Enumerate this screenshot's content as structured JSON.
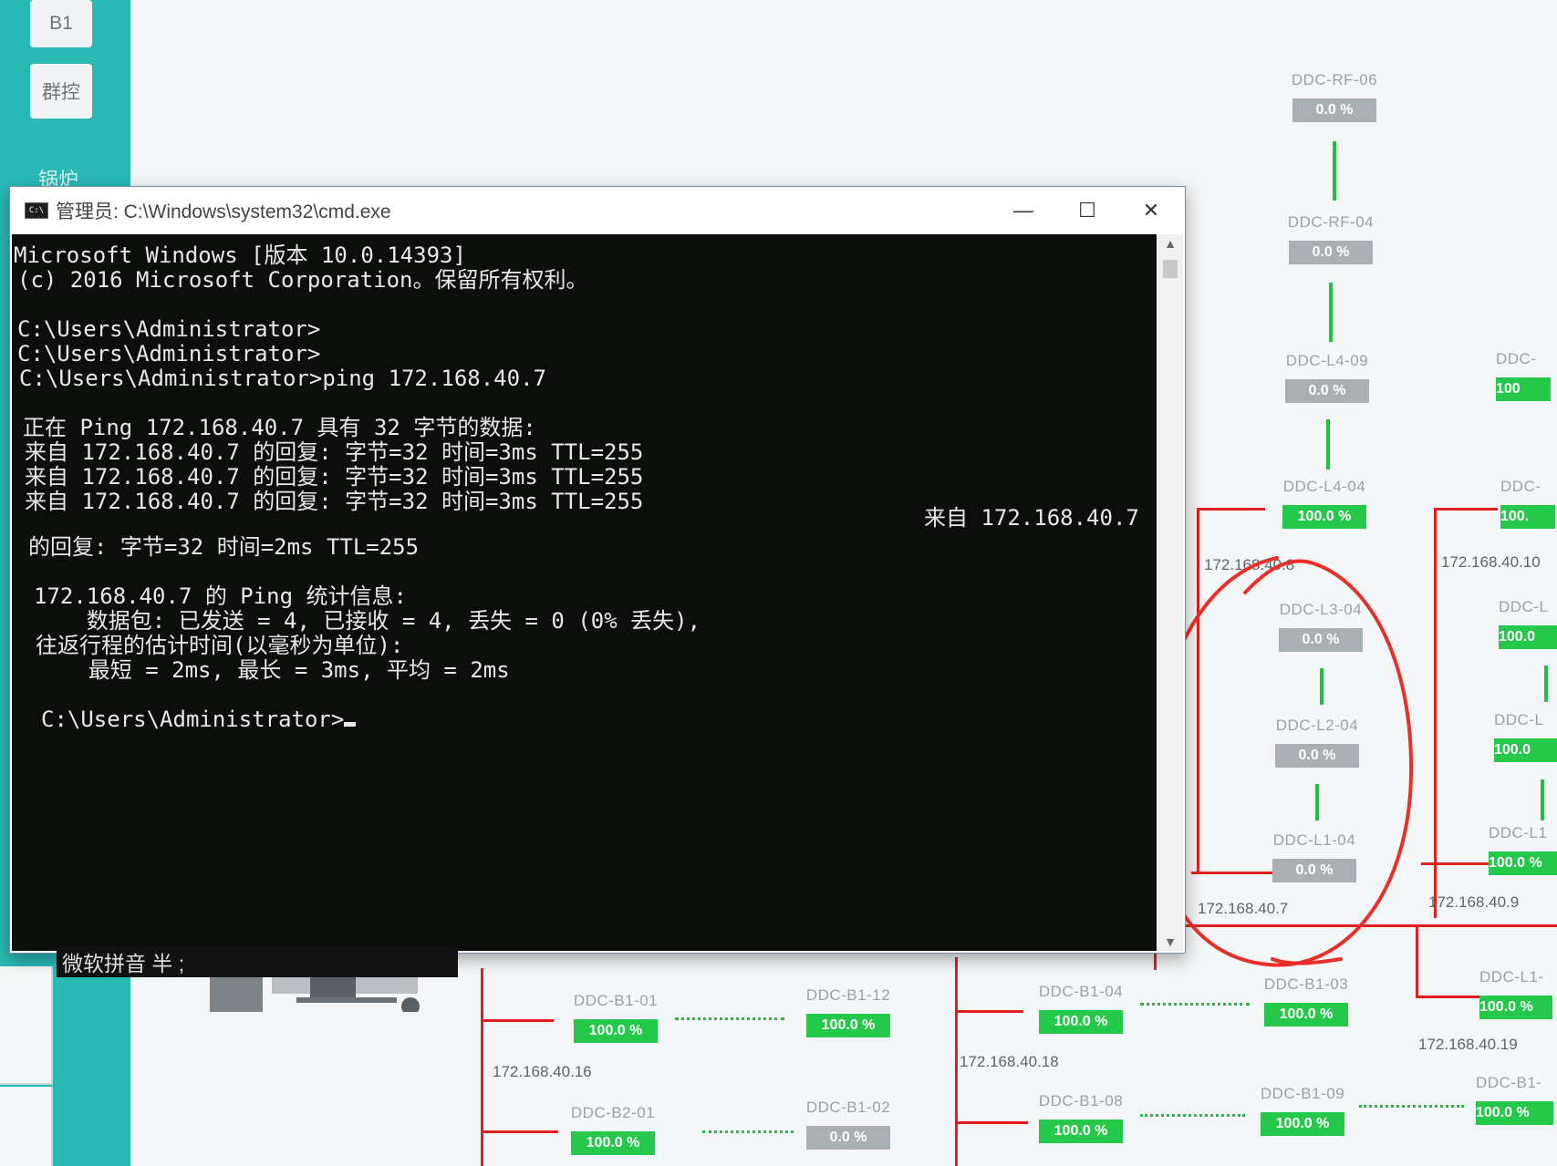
{
  "sidebar": {
    "buttons": [
      "B1",
      "群控"
    ],
    "label": "锅炉"
  },
  "topology": {
    "nodes": [
      {
        "label": "DDC-RF-06",
        "badge": "0.0 %",
        "ok": false
      },
      {
        "label": "DDC-RF-04",
        "badge": "0.0 %",
        "ok": false
      },
      {
        "label": "DDC-L4-09",
        "badge": "0.0 %",
        "ok": false
      },
      {
        "label": "DDC-L4-04",
        "badge": "100.0 %",
        "ok": true
      },
      {
        "label": "DDC-L3-04",
        "badge": "0.0 %",
        "ok": false
      },
      {
        "label": "DDC-L2-04",
        "badge": "0.0 %",
        "ok": false
      },
      {
        "label": "DDC-L1-04",
        "badge": "0.0 %",
        "ok": false
      },
      {
        "label": "DDC-",
        "badge": "100",
        "ok": true
      },
      {
        "label": "DDC-",
        "badge": "100.",
        "ok": true
      },
      {
        "label": "DDC-L",
        "badge": "100.0",
        "ok": true
      },
      {
        "label": "DDC-L",
        "badge": "100.0",
        "ok": true
      },
      {
        "label": "DDC-L1",
        "badge": "100.0 %",
        "ok": true
      },
      {
        "label": "DDC-B1-01",
        "badge": "100.0 %",
        "ok": true
      },
      {
        "label": "DDC-B1-12",
        "badge": "100.0 %",
        "ok": true
      },
      {
        "label": "DDC-B1-04",
        "badge": "100.0 %",
        "ok": true
      },
      {
        "label": "DDC-B1-03",
        "badge": "100.0 %",
        "ok": true
      },
      {
        "label": "DDC-L1-",
        "badge": "100.0 %",
        "ok": true
      },
      {
        "label": "DDC-B2-01",
        "badge": "100.0 %",
        "ok": true
      },
      {
        "label": "DDC-B1-02",
        "badge": "0.0 %",
        "ok": false
      },
      {
        "label": "DDC-B1-08",
        "badge": "100.0 %",
        "ok": true
      },
      {
        "label": "DDC-B1-09",
        "badge": "100.0 %",
        "ok": true
      },
      {
        "label": "DDC-B1-",
        "badge": "100.0 %",
        "ok": true
      }
    ],
    "ips": [
      "172.168.40.8",
      "172.168.40.10",
      "172.168.40.7",
      "172.168.40.9",
      "172.168.40.16",
      "172.168.40.18",
      "172.168.40.19"
    ]
  },
  "cmd": {
    "title": "管理员: C:\\Windows\\system32\\cmd.exe",
    "icon_text": "C:\\",
    "minimize": "—",
    "maximize": "☐",
    "close": "✕",
    "lines": [
      "Microsoft Windows [版本 10.0.14393]",
      "(c) 2016 Microsoft Corporation。保留所有权利。",
      "C:\\Users\\Administrator>",
      "C:\\Users\\Administrator>",
      "C:\\Users\\Administrator>ping 172.168.40.7",
      "正在 Ping 172.168.40.7 具有 32 字节的数据:",
      "来自 172.168.40.7 的回复: 字节=32 时间=3ms TTL=255",
      "来自 172.168.40.7 的回复: 字节=32 时间=3ms TTL=255",
      "来自 172.168.40.7 的回复: 字节=32 时间=3ms TTL=255",
      "来自 172.168.40.7",
      "的回复: 字节=32 时间=2ms TTL=255",
      "172.168.40.7 的 Ping 统计信息:",
      "    数据包: 已发送 = 4, 已接收 = 4, 丢失 = 0 (0% 丢失),",
      "往返行程的估计时间(以毫秒为单位):",
      "    最短 = 2ms, 最长 = 3ms, 平均 = 2ms",
      "C:\\Users\\Administrator>"
    ],
    "scroll_up": "▲",
    "scroll_down": "▼"
  },
  "ime": "微软拼音 半 ;",
  "colors": {
    "accent": "#2bb9b6",
    "ok": "#25c84a",
    "offline": "#a9b0b3",
    "link_red": "#e02020",
    "annotation": "#e8302a"
  }
}
